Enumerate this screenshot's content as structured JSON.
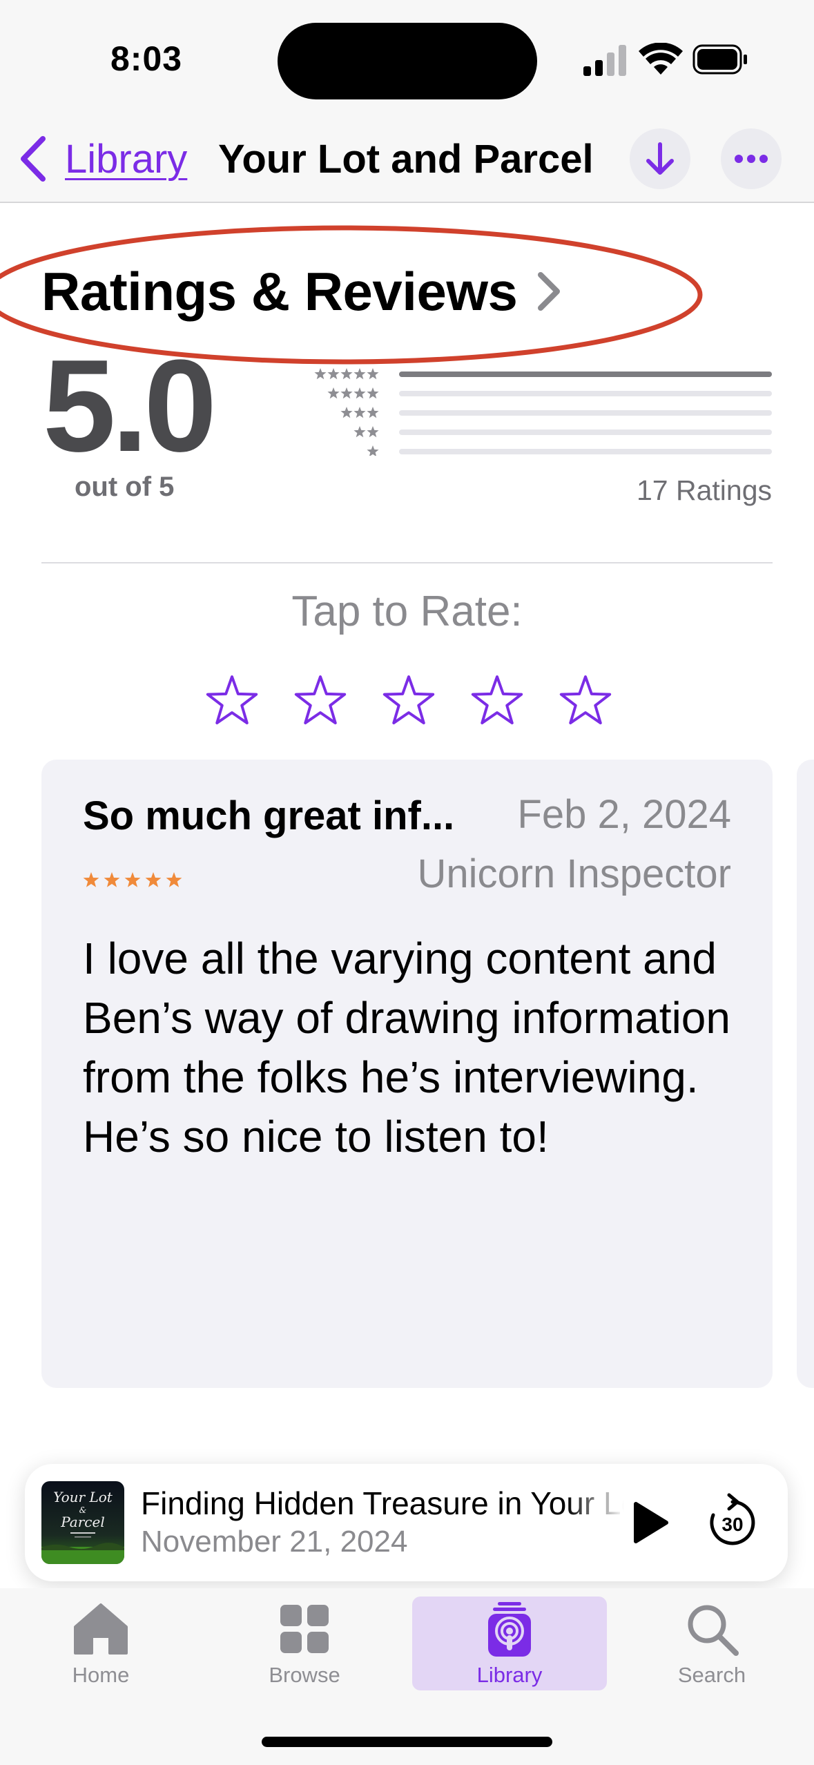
{
  "status_bar": {
    "time": "8:03"
  },
  "nav": {
    "back_label": "Library",
    "title": "Your Lot and Parcel",
    "accent_color": "#7b2ce6",
    "download_icon": "arrow-down-icon",
    "more_icon": "ellipsis-icon"
  },
  "ratings": {
    "header": "Ratings & Reviews",
    "score": "5.0",
    "out_of": "out of 5",
    "count_label": "17 Ratings",
    "distribution": [
      {
        "stars": 5,
        "fraction": 1.0
      },
      {
        "stars": 4,
        "fraction": 0.0
      },
      {
        "stars": 3,
        "fraction": 0.0
      },
      {
        "stars": 2,
        "fraction": 0.0
      },
      {
        "stars": 1,
        "fraction": 0.0
      }
    ],
    "annotation_color": "#d0412c"
  },
  "tap_to_rate": {
    "label": "Tap to Rate:",
    "star_count": 5
  },
  "review": {
    "title": "So much great inf...",
    "date": "Feb 2, 2024",
    "author": "Unicorn Inspector",
    "rating": 5,
    "star_color": "#f08a3a",
    "body": "I love all the varying content and Ben’s way of drawing information from the folks he’s interviewing. He’s so nice to listen to!"
  },
  "mini_player": {
    "artwork_text_line1": "Your Lot",
    "artwork_text_line2": "&",
    "artwork_text_line3": "Parcel",
    "title": "Finding Hidden Treasure in Your Lot",
    "date": "November 21, 2024",
    "skip_seconds": "30"
  },
  "tabs": [
    {
      "label": "Home",
      "icon": "house-icon",
      "active": false
    },
    {
      "label": "Browse",
      "icon": "grid-icon",
      "active": false
    },
    {
      "label": "Library",
      "icon": "podcast-stack-icon",
      "active": true
    },
    {
      "label": "Search",
      "icon": "magnifier-icon",
      "active": false
    }
  ]
}
